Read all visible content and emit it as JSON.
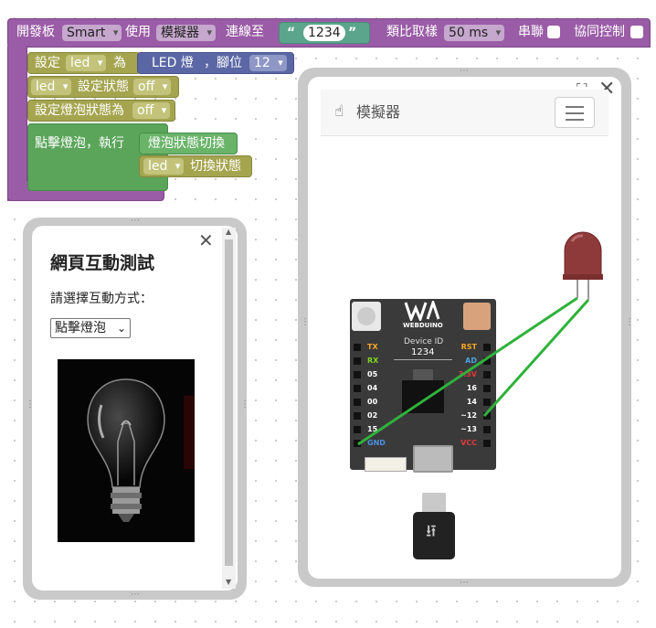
{
  "board_block": {
    "prefix": "開發板",
    "board_type": "Smart",
    "use_label": "使用",
    "mode": "模擬器",
    "connect_label": "連線至",
    "device_id": "1234",
    "sample_label": "類比取樣",
    "sample_rate": "50 ms",
    "serial_label": "串聯",
    "collab_label": "協同控制"
  },
  "set_block": {
    "set_label": "設定",
    "var": "led",
    "as_label": "為",
    "component": "LED 燈",
    "pin_label": "，腳位",
    "pin": "12"
  },
  "state_block": {
    "var": "led",
    "label": "設定狀態",
    "value": "off"
  },
  "bulb_state_block": {
    "label": "設定燈泡狀態為",
    "value": "off"
  },
  "click_block": {
    "label": "點擊燈泡，執行",
    "toggle_label": "燈泡狀態切換",
    "var": "led",
    "toggle_action": "切換狀態"
  },
  "simulator": {
    "title": "模擬器",
    "board": {
      "brand": "WEBDUINO",
      "device_id_label": "Device ID",
      "device_id": "1234",
      "left_pins": [
        "TX",
        "RX",
        "05",
        "04",
        "00",
        "02",
        "15",
        "GND"
      ],
      "right_pins": [
        "RST",
        "AD",
        "3.3V",
        "16",
        "14",
        "~12",
        "~13",
        "VCC"
      ]
    }
  },
  "interaction_panel": {
    "title": "網頁互動測試",
    "prompt": "請選擇互動方式：",
    "select_value": "點擊燈泡"
  },
  "colors": {
    "purple": "#9a5ca6",
    "olive": "#a5a550",
    "green": "#5ba55b",
    "blue": "#5b67a5",
    "teal": "#5ba58c",
    "wire": "#2fb23a",
    "board": "#3a3a3a"
  }
}
